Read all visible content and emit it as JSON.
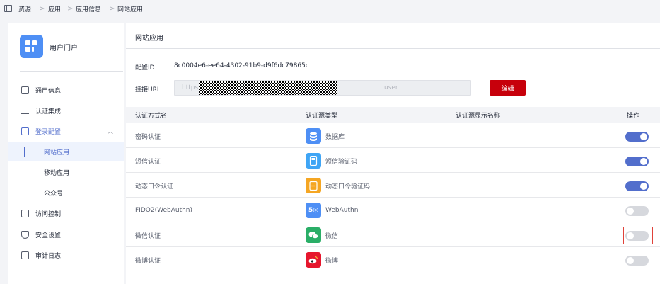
{
  "breadcrumb": {
    "items": [
      "资源",
      "应用",
      "应用信息",
      "网站应用"
    ],
    "separator": ">"
  },
  "sidebar": {
    "app_name": "用户门户",
    "menu": [
      {
        "label": "通用信息",
        "icon": "info-icon"
      },
      {
        "label": "认证集成",
        "icon": "integration-icon"
      },
      {
        "label": "登录配置",
        "icon": "login-config-icon",
        "expanded": true,
        "children": [
          "网站应用",
          "移动应用",
          "公众号"
        ],
        "active_child": "网站应用"
      },
      {
        "label": "访问控制",
        "icon": "access-control-icon"
      },
      {
        "label": "安全设置",
        "icon": "shield-icon"
      },
      {
        "label": "审计日志",
        "icon": "audit-log-icon"
      }
    ]
  },
  "main": {
    "title": "网站应用",
    "config_id_label": "配置ID",
    "config_id_value": "8c0004e6-ee64-4302-91b9-d9f6dc79865c",
    "url_label": "挂接URL",
    "url_prefix": "https://",
    "url_suffix": "user",
    "edit_button": "编辑"
  },
  "table": {
    "headers": [
      "认证方式名",
      "认证源类型",
      "认证源显示名称",
      "操作"
    ],
    "rows": [
      {
        "method": "密码认证",
        "source": "数据库",
        "display_name": "",
        "enabled": true,
        "icon": "database-icon",
        "icon_color": "#4e8ff5"
      },
      {
        "method": "短信认证",
        "source": "短信验证码",
        "display_name": "",
        "enabled": true,
        "icon": "sms-icon",
        "icon_color": "#3fa5f5"
      },
      {
        "method": "动态口令认证",
        "source": "动态口令验证码",
        "display_name": "",
        "enabled": true,
        "icon": "otp-icon",
        "icon_color": "#f5a623"
      },
      {
        "method": "FIDO2(WebAuthn)",
        "source": "WebAuthn",
        "display_name": "",
        "enabled": false,
        "icon": "webauthn-icon",
        "icon_color": "#4e8ff5"
      },
      {
        "method": "微信认证",
        "source": "微信",
        "display_name": "",
        "enabled": false,
        "icon": "wechat-icon",
        "icon_color": "#2aae67",
        "highlighted": true
      },
      {
        "method": "微博认证",
        "source": "微博",
        "display_name": "",
        "enabled": false,
        "icon": "weibo-icon",
        "icon_color": "#e6162d"
      }
    ]
  },
  "colors": {
    "accent": "#526ecc",
    "danger": "#c7000b",
    "highlight": "#e0423a"
  }
}
